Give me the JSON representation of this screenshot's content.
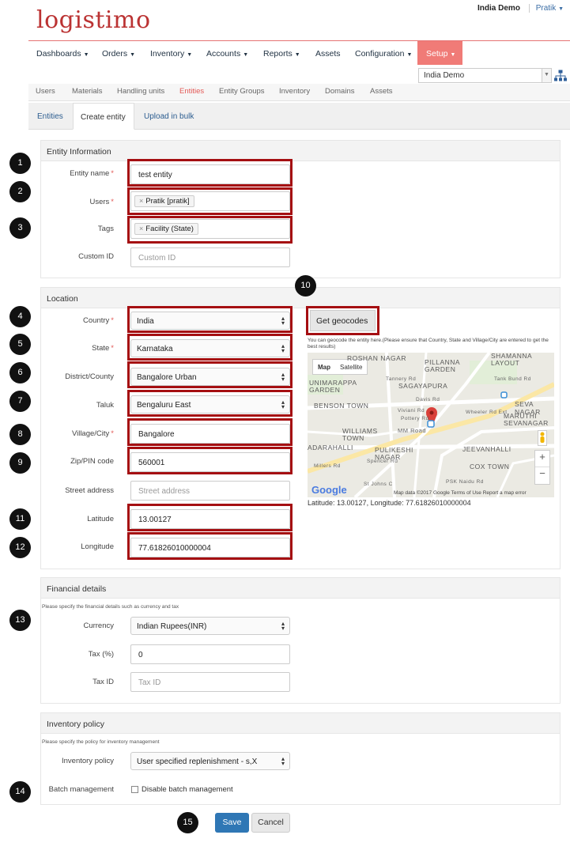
{
  "header": {
    "logo_text": "logistimo",
    "domain_name": "India Demo",
    "user_menu": "Pratik"
  },
  "nav": {
    "items": [
      "Dashboards",
      "Orders",
      "Inventory",
      "Accounts",
      "Reports",
      "Assets",
      "Configuration"
    ],
    "setup": "Setup",
    "domain_select": "India Demo"
  },
  "subnav": [
    "Users",
    "Materials",
    "Handling units",
    "Entities",
    "Entity Groups",
    "Inventory",
    "Domains",
    "Assets"
  ],
  "tabs": [
    "Entities",
    "Create entity",
    "Upload in bulk"
  ],
  "entity_info": {
    "title": "Entity Information",
    "entity_name_label": "Entity name",
    "entity_name_value": "test entity",
    "users_label": "Users",
    "users_chip": "Pratik [pratik]",
    "tags_label": "Tags",
    "tags_chip": "Facility (State)",
    "custom_id_label": "Custom ID",
    "custom_id_placeholder": "Custom ID"
  },
  "location": {
    "title": "Location",
    "country_label": "Country",
    "country_value": "India",
    "state_label": "State",
    "state_value": "Karnataka",
    "district_label": "District/County",
    "district_value": "Bangalore Urban",
    "taluk_label": "Taluk",
    "taluk_value": "Bengaluru East",
    "village_label": "Village/City",
    "village_value": "Bangalore",
    "zip_label": "Zip/PIN code",
    "zip_value": "560001",
    "street_label": "Street address",
    "street_placeholder": "Street address",
    "latitude_label": "Latitude",
    "latitude_value": "13.00127",
    "longitude_label": "Longitude",
    "longitude_value": "77.61826010000004",
    "geocode_button": "Get geocodes",
    "geocode_note": "You can geocode the entity here.(Please ensure that Country, State and Village/City are entered to get the best results)",
    "latlng_text": "Latitude: 13.00127, Longitude: 77.61826010000004"
  },
  "map": {
    "map_label": "Map",
    "satellite_label": "Satellite",
    "places": [
      "ROSHAN NAGAR",
      "PILLANNA GARDEN",
      "SHAMANNA LAYOUT",
      "UNIMARAPPA GARDEN",
      "SAGAYAPURA",
      "BENSON TOWN",
      "SEVA NAGAR",
      "MARUTHI SEVANAGAR",
      "WILLIAMS TOWN",
      "ADARAHALLI",
      "PULIKESHI NAGAR",
      "JEEVANHALLI",
      "COX TOWN"
    ],
    "streets": [
      "Tank Bund Rd",
      "Davis Rd",
      "Viviani Rd",
      "Pottery Rd",
      "MM Road",
      "Millers Rd",
      "Spencer Rd",
      "PSK Naidu Rd",
      "Tannery Rd",
      "Wheeler Rd Ext",
      "St Johns C"
    ],
    "google_logo": "Google",
    "footer": "Map data ©2017 Google   Terms of Use   Report a map error",
    "zoom_in": "+",
    "zoom_out": "−"
  },
  "financial": {
    "title": "Financial details",
    "hint": "Please specify the financial details such as currency and tax",
    "currency_label": "Currency",
    "currency_value": "Indian Rupees(INR)",
    "tax_label": "Tax (%)",
    "tax_value": "0",
    "taxid_label": "Tax ID",
    "taxid_placeholder": "Tax ID"
  },
  "inventory": {
    "title": "Inventory policy",
    "hint": "Please specify the policy for inventory management",
    "policy_label": "Inventory policy",
    "policy_value": "User specified replenishment - s,X",
    "batch_label": "Batch management",
    "batch_checkbox": "Disable batch management"
  },
  "buttons": {
    "save": "Save",
    "cancel": "Cancel"
  },
  "badges": [
    "1",
    "2",
    "3",
    "4",
    "5",
    "6",
    "7",
    "8",
    "9",
    "10",
    "11",
    "12",
    "13",
    "14",
    "15"
  ],
  "colors": {
    "accent": "#f07b77",
    "highlight": "#a50f12",
    "primary": "#2f77b5"
  }
}
